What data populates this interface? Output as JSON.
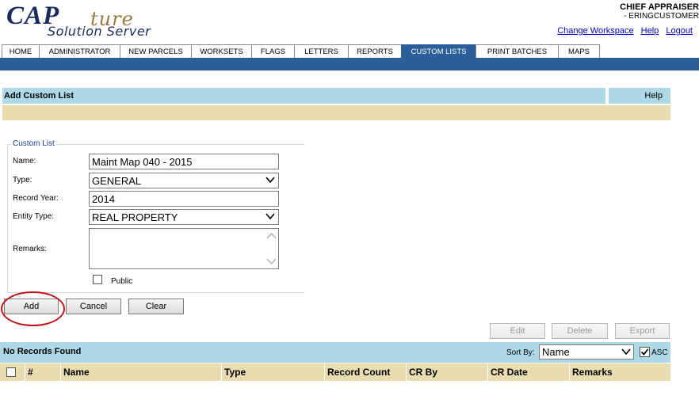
{
  "app": {
    "logo_cap": "CAP",
    "logo_ture": "ture",
    "logo_sub": "Solution Server"
  },
  "user": {
    "role": "CHIEF  APPRAISER",
    "name": "- ERINGCUSTOMER"
  },
  "top_links": {
    "change_workspace": "Change Workspace",
    "help": "Help",
    "logout": "Logout"
  },
  "nav": {
    "tabs": [
      {
        "label": "HOME"
      },
      {
        "label": "ADMINISTRATOR"
      },
      {
        "label": "NEW PARCELS"
      },
      {
        "label": "WORKSETS"
      },
      {
        "label": "FLAGS"
      },
      {
        "label": "LETTERS"
      },
      {
        "label": "REPORTS"
      },
      {
        "label": "CUSTOM LISTS"
      },
      {
        "label": "PRINT BATCHES"
      },
      {
        "label": "MAPS"
      }
    ],
    "active_tab": "CUSTOM LISTS"
  },
  "page": {
    "title": "Add Custom List",
    "help": "Help"
  },
  "form": {
    "legend": "Custom List",
    "name_label": "Name:",
    "name_value": "Maint Map 040 - 2015",
    "type_label": "Type:",
    "type_value": "GENERAL",
    "record_year_label": "Record Year:",
    "record_year_value": "2014",
    "entity_type_label": "Entity Type:",
    "entity_type_value": "REAL PROPERTY",
    "remarks_label": "Remarks:",
    "remarks_value": "",
    "public_label": "Public",
    "public_checked": false
  },
  "buttons": {
    "add": "Add",
    "cancel": "Cancel",
    "clear": "Clear",
    "edit": "Edit",
    "delete": "Delete",
    "export": "Export"
  },
  "list": {
    "status": "No Records Found",
    "sort_label": "Sort By:",
    "sort_value": "Name",
    "asc_label": "ASC",
    "asc_checked": true,
    "columns": [
      "#",
      "Name",
      "Type",
      "Record Count",
      "CR By",
      "CR Date",
      "Remarks"
    ]
  },
  "colors": {
    "nav_blue": "#2c5f9a",
    "light_blue": "#add8e6",
    "tan": "#e8dcb0",
    "highlight_red": "#c0141c"
  }
}
